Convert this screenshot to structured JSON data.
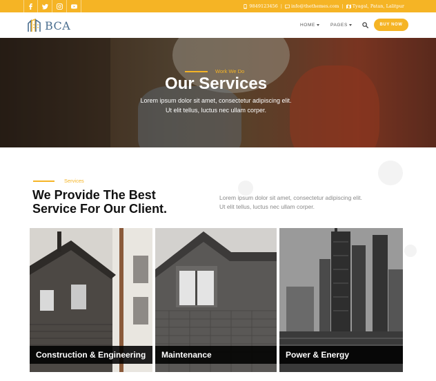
{
  "topbar": {
    "social_icons": [
      "facebook-icon",
      "twitter-icon",
      "instagram-icon",
      "youtube-icon"
    ],
    "phone": "9849123456",
    "email": "info@thethemes.com",
    "address": "Tyagal, Patan, Lalitpur"
  },
  "nav": {
    "logo_text": "BCA",
    "items": [
      {
        "label": "HOME"
      },
      {
        "label": "PAGES"
      }
    ],
    "buy_label": "BUY NOW"
  },
  "hero": {
    "kicker": "Work We Do",
    "title": "Our Services",
    "text_line1": "Lorem ipsum dolor sit amet, consectetur adipiscing elit.",
    "text_line2": "Ut elit tellus, luctus nec ullam corper."
  },
  "services": {
    "kicker": "Services",
    "title_line1": "We Provide The Best",
    "title_line2": "Service For Our Client.",
    "text_line1": "Lorem ipsum dolor sit amet, consectetur adipiscing elit.",
    "text_line2": "Ut elit tellus, luctus nec ullam corper.",
    "cards": [
      {
        "label": "Construction & Engineering"
      },
      {
        "label": "Maintenance"
      },
      {
        "label": "Power & Energy"
      }
    ]
  },
  "colors": {
    "accent": "#f5b425",
    "logo": "#4a6e8f",
    "title_dark": "#111111"
  }
}
